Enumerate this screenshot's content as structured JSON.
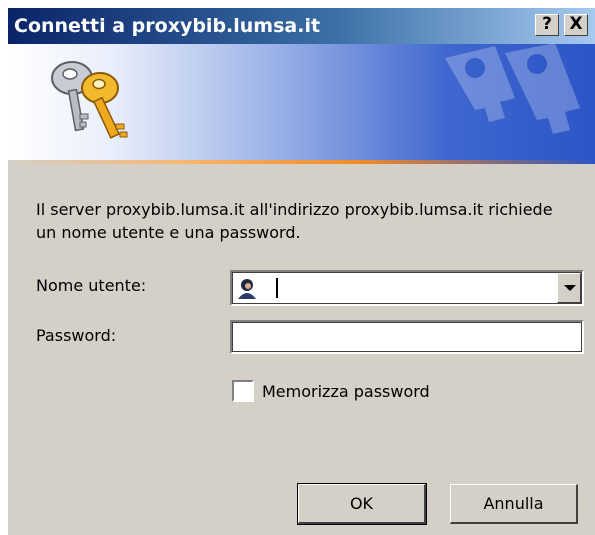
{
  "dialog": {
    "title": "Connetti a proxybib.lumsa.it",
    "help_button": "?",
    "close_button": "X",
    "banner_icon": "keys-icon",
    "message": "Il server proxybib.lumsa.it all'indirizzo proxybib.lumsa.it richiede un nome utente e una password.",
    "username": {
      "label": "Nome utente:",
      "value": "",
      "icon": "user-icon"
    },
    "password": {
      "label": "Password:",
      "value": ""
    },
    "remember": {
      "label": "Memorizza password",
      "checked": false
    },
    "ok_label": "OK",
    "cancel_label": "Annulla"
  },
  "colors": {
    "title_start": "#0a246a",
    "title_end": "#a6caf0",
    "dialog_bg": "#d4d0c8",
    "banner_accent": "#2c55c6",
    "banner_line": "#f28a25"
  }
}
